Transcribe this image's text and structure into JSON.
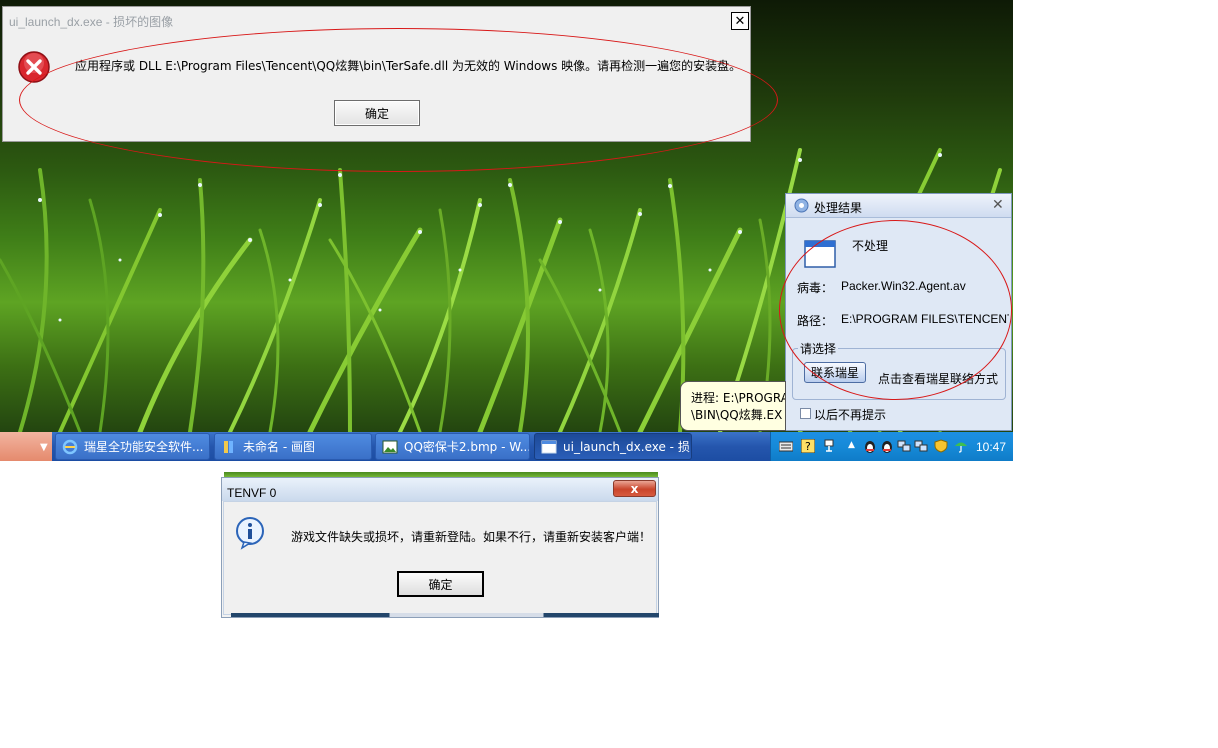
{
  "error_dialog": {
    "title": "ui_launch_dx.exe - 损坏的图像",
    "close_glyph": "✕",
    "message": "应用程序或 DLL E:\\Program Files\\Tencent\\QQ炫舞\\bin\\TerSafe.dll 为无效的 Windows 映像。请再检测一遍您的安装盘。",
    "ok_label": "确定"
  },
  "result_panel": {
    "title": "处理结果",
    "close_glyph": "✕",
    "action": "不处理",
    "virus_label": "病毒：",
    "virus_value": "Packer.Win32.Agent.av",
    "path_label": "路径：",
    "path_value": "E:\\PROGRAM FILES\\TENCENT\\",
    "choose_label": "请选择",
    "contact_button": "联系瑞星",
    "contact_hint": "点击查看瑞星联络方式",
    "no_remind_label": "以后不再提示"
  },
  "balloon": {
    "line1": "进程: E:\\PROGRA",
    "line2": "\\BIN\\QQ炫舞.EX"
  },
  "taskbar": {
    "buttons": [
      {
        "label": "瑞星全功能安全软件...",
        "icon": "ie-icon",
        "active": false
      },
      {
        "label": "未命名 - 画图",
        "icon": "paint-icon",
        "active": false
      },
      {
        "label": "QQ密保卡2.bmp - W...",
        "icon": "image-viewer-icon",
        "active": false
      },
      {
        "label": "ui_launch_dx.exe - 损...",
        "icon": "window-icon",
        "active": true
      }
    ],
    "clock": "10:47"
  },
  "tenvf_dialog": {
    "title": "TENVF 0",
    "close_glyph": "x",
    "message": "游戏文件缺失或损坏，请重新登陆。如果不行，请重新安装客户端！",
    "ok_label": "确定"
  },
  "colors": {
    "annotation": "#d81818",
    "taskbar": "#2556ad",
    "tray": "#168ad8"
  }
}
